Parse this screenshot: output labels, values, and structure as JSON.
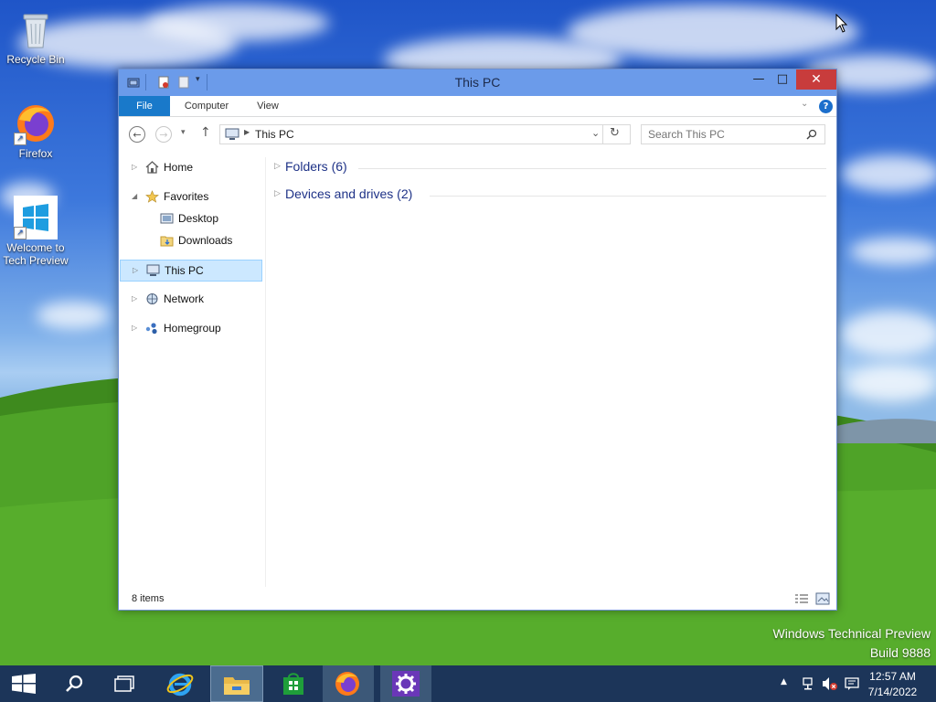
{
  "desktop": {
    "icons": [
      {
        "label": "Recycle Bin",
        "icon": "recycle-bin-icon"
      },
      {
        "label": "Firefox",
        "icon": "firefox-icon"
      },
      {
        "label": "Welcome to Tech Preview",
        "icon": "windows-logo-icon"
      }
    ],
    "watermark": {
      "line1": "Windows Technical Preview",
      "line2": "Build 9888"
    }
  },
  "window": {
    "title": "This PC",
    "controls": {
      "minimize": "—",
      "maximize": "□",
      "close": "✕"
    },
    "ribbon": {
      "tabs": [
        "File",
        "Computer",
        "View"
      ],
      "help": "?"
    },
    "address": {
      "path": "This PC"
    },
    "search": {
      "placeholder": "Search This PC"
    },
    "nav_tree": [
      {
        "label": "Home",
        "icon": "home-icon"
      },
      {
        "label": "Favorites",
        "icon": "star-icon"
      },
      {
        "label": "Desktop",
        "icon": "desktop-folder-icon"
      },
      {
        "label": "Downloads",
        "icon": "downloads-folder-icon"
      },
      {
        "label": "This PC",
        "icon": "computer-icon",
        "selected": true
      },
      {
        "label": "Network",
        "icon": "network-icon"
      },
      {
        "label": "Homegroup",
        "icon": "homegroup-icon"
      }
    ],
    "groups": [
      {
        "label": "Folders (6)"
      },
      {
        "label": "Devices and drives (2)"
      }
    ],
    "status": {
      "item_count": "8 items"
    }
  },
  "taskbar": {
    "buttons": [
      {
        "name": "start",
        "icon": "windows-logo-icon"
      },
      {
        "name": "search",
        "icon": "search-icon"
      },
      {
        "name": "task-view",
        "icon": "task-view-icon"
      },
      {
        "name": "internet-explorer",
        "icon": "internet-explorer-icon"
      },
      {
        "name": "file-explorer",
        "icon": "file-explorer-icon",
        "active": true
      },
      {
        "name": "store",
        "icon": "store-icon"
      },
      {
        "name": "firefox",
        "icon": "firefox-icon",
        "running": true
      },
      {
        "name": "settings",
        "icon": "gear-icon",
        "running": true
      }
    ],
    "tray": {
      "time": "12:57 AM",
      "date": "7/14/2022"
    }
  },
  "colors": {
    "titlebar": "#6b9bea",
    "close_button": "#c83c3c",
    "file_tab": "#1979ca",
    "selection": "#cce8ff",
    "taskbar": "#1c3559",
    "group_text": "#1e3287"
  }
}
